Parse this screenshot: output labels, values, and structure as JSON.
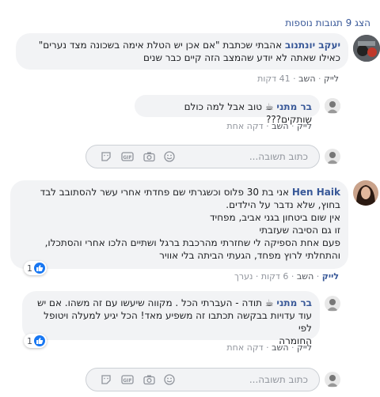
{
  "header": {
    "more_replies": "הצג 9 תגובות נוספות"
  },
  "comments": [
    {
      "author": "יעקב יונתנוב",
      "text_line1": "אהבתי שכתבת \"אם אכן יש הטלת אימה בשכונה מצד נערים\"",
      "text_line2": "כאילו שאתה לא יודע שהמצב הזה קיים כבר שנים",
      "like": "לייק",
      "reply": "השב",
      "time": "41 דקות"
    },
    {
      "author": "בר מתני",
      "text_line1": "טוב אבל למה כולם שותקים???",
      "like": "לייק",
      "reply": "השב",
      "time": "דקה אחת"
    },
    {
      "author": "Hen Haik",
      "lines": [
        "אני בת 30 פלוס וכשגרתי שם פחדתי אחרי עשר להסתובב לבד",
        "בחוץ, שלא נדבר על הילדים.",
        "אין שום ביטחון בגני אביב, מפחיד",
        "זו גם הסיבה שעזבתי",
        "פעם אחת הספיקה לי שחזרתי מהרכבת ברגל ושתיים הלכו אחרי והסתכלו,",
        "והתחלתי לרוץ מפחד, הגעתי הביתה בלי אוויר"
      ],
      "like": "לייק",
      "reply": "השב",
      "time": "6 דקות",
      "edited": "נערך",
      "reactions": "1"
    },
    {
      "author": "בר מתני",
      "text_line1": "תודה - העברתי הכל . מקווה שיעשו עם זה משהו. אם יש",
      "lines": [
        "עוד עדויות בבקשה תכתבו זה משפיע מאד! הכל יגיע למעלה ויטופל לפי",
        "החומרה"
      ],
      "like": "לייק",
      "reply": "השב",
      "time": "דקה אחת",
      "reactions": "1"
    }
  ],
  "reply_box": {
    "placeholder": "כתוב תשובה..."
  },
  "colors": {
    "link": "#385898",
    "bubble": "#f2f3f5",
    "like_blue": "#1877f2"
  }
}
